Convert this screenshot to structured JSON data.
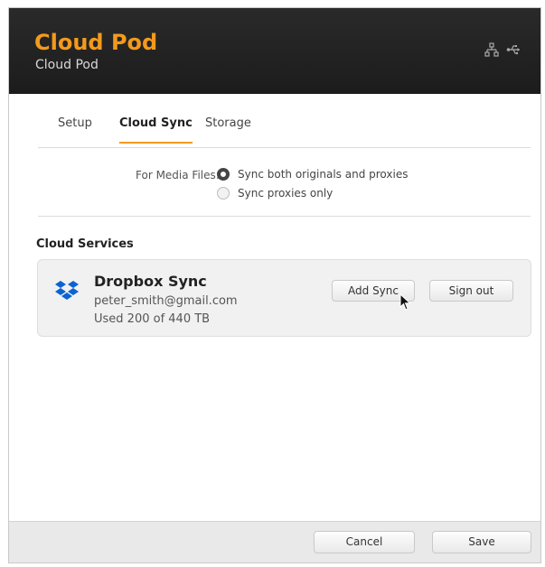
{
  "header": {
    "device_name": "Cloud Pod",
    "device_subtitle": "Cloud Pod",
    "accent": "#f39a1c",
    "icons": [
      "network-icon",
      "usb-icon"
    ]
  },
  "tabs": [
    {
      "label": "Setup",
      "active": false
    },
    {
      "label": "Cloud Sync",
      "active": true
    },
    {
      "label": "Storage",
      "active": false
    }
  ],
  "media_files": {
    "label": "For Media Files:",
    "options": [
      {
        "label": "Sync both originals and proxies",
        "selected": true
      },
      {
        "label": "Sync proxies only",
        "selected": false
      }
    ]
  },
  "cloud_services": {
    "title": "Cloud Services",
    "service": {
      "icon": "dropbox-icon",
      "name": "Dropbox Sync",
      "email": "peter_smith@gmail.com",
      "usage": "Used 200 of 440 TB",
      "add_label": "Add Sync",
      "signout_label": "Sign out"
    }
  },
  "footer": {
    "cancel_label": "Cancel",
    "save_label": "Save"
  }
}
